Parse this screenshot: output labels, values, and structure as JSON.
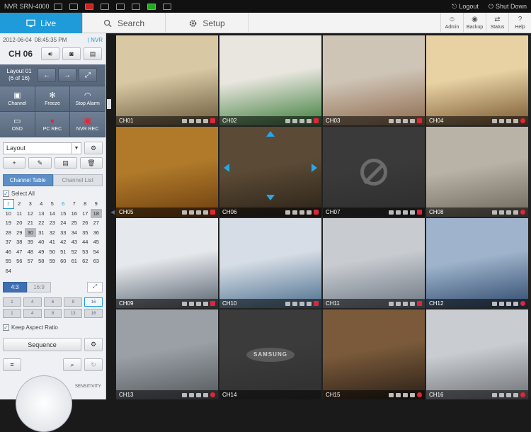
{
  "titlebar": {
    "model": "NVR SRN-4000",
    "logout": "Logout",
    "shutdown": "Shut Down"
  },
  "nav": {
    "tabs": [
      {
        "label": "Live",
        "active": true
      },
      {
        "label": "Search",
        "active": false
      },
      {
        "label": "Setup",
        "active": false
      }
    ],
    "right": [
      {
        "label": "Admin",
        "icon": "user-icon"
      },
      {
        "label": "Backup",
        "icon": "backup-icon"
      },
      {
        "label": "Status",
        "icon": "status-icon"
      },
      {
        "label": "Help",
        "icon": "help-icon"
      }
    ]
  },
  "panel": {
    "date": "2012-06-04",
    "time": "08:45:35 PM",
    "nvr_label": "NVR",
    "channel": "CH 06",
    "layout_title": "Layout 01",
    "layout_page": "(6 of 16)",
    "ops": [
      {
        "label": "Channel",
        "icon": "channel-icon"
      },
      {
        "label": "Freeze",
        "icon": "freeze-icon"
      },
      {
        "label": "Stop Alarm",
        "icon": "alarm-icon"
      },
      {
        "label": "OSD",
        "icon": "osd-icon"
      },
      {
        "label": "PC REC",
        "icon": "pc-rec-icon"
      },
      {
        "label": "NVR REC",
        "icon": "nvr-rec-icon"
      }
    ],
    "layout_select": "Layout",
    "channel_tabs": [
      "Channel Table",
      "Channel List"
    ],
    "select_all": "Select All",
    "channels": [
      [
        "1",
        "2",
        "3",
        "4",
        "5",
        "6",
        "7",
        "8",
        "9"
      ],
      [
        "10",
        "11",
        "12",
        "13",
        "14",
        "15",
        "16",
        "17",
        "18"
      ],
      [
        "19",
        "20",
        "21",
        "22",
        "23",
        "24",
        "25",
        "26",
        "27"
      ],
      [
        "28",
        "29",
        "30",
        "31",
        "32",
        "33",
        "34",
        "35",
        "36"
      ],
      [
        "37",
        "38",
        "39",
        "40",
        "41",
        "42",
        "43",
        "44",
        "45"
      ],
      [
        "46",
        "47",
        "48",
        "49",
        "50",
        "51",
        "52",
        "53",
        "54"
      ],
      [
        "55",
        "56",
        "57",
        "58",
        "59",
        "60",
        "61",
        "62",
        "63"
      ],
      [
        "64"
      ]
    ],
    "aspect_options": [
      "4:3",
      "16:9"
    ],
    "layout_icons": [
      "1",
      "4",
      "6",
      "9",
      "16",
      "1",
      "4",
      "8",
      "13",
      "16"
    ],
    "keep_aspect": "Keep Aspect Ratio",
    "sequence": "Sequence",
    "sensitivity": "SENSITIVITY"
  },
  "cameras": [
    {
      "id": "CH01",
      "scene": [
        "#d8c9a4",
        "#6d5a3c"
      ]
    },
    {
      "id": "CH02",
      "scene": [
        "#e9e6df",
        "#3f7e3d"
      ]
    },
    {
      "id": "CH03",
      "scene": [
        "#cfc5b7",
        "#8e6b4d"
      ]
    },
    {
      "id": "CH04",
      "scene": [
        "#e8d2a4",
        "#7b5a33"
      ]
    },
    {
      "id": "CH05",
      "scene": [
        "#b07a2a",
        "#6e3f10"
      ]
    },
    {
      "id": "CH06",
      "scene": [
        "#5b4a35",
        "#2a2218"
      ]
    },
    {
      "id": "CH07",
      "scene": [
        "#3a3a3a",
        "#2d2d2d"
      ],
      "no_signal": true
    },
    {
      "id": "CH08",
      "scene": [
        "#b9b3a7",
        "#6d665a"
      ]
    },
    {
      "id": "CH09",
      "scene": [
        "#e5e8ec",
        "#5a6470"
      ]
    },
    {
      "id": "CH10",
      "scene": [
        "#d6dde6",
        "#4c6f8d"
      ]
    },
    {
      "id": "CH11",
      "scene": [
        "#c8ccd1",
        "#6e7782"
      ]
    },
    {
      "id": "CH12",
      "scene": [
        "#9fb4cc",
        "#2f4a6e"
      ]
    },
    {
      "id": "CH13",
      "scene": [
        "#9aa0a6",
        "#55595e"
      ]
    },
    {
      "id": "CH14",
      "scene": [
        "#3b3b3b",
        "#2f2f2f"
      ],
      "samsung": "SAMSUNG"
    },
    {
      "id": "CH15",
      "scene": [
        "#7a5a3a",
        "#2b2018"
      ]
    },
    {
      "id": "CH16",
      "scene": [
        "#c9ccd0",
        "#6e7378"
      ]
    }
  ],
  "active_camera": "CH06"
}
